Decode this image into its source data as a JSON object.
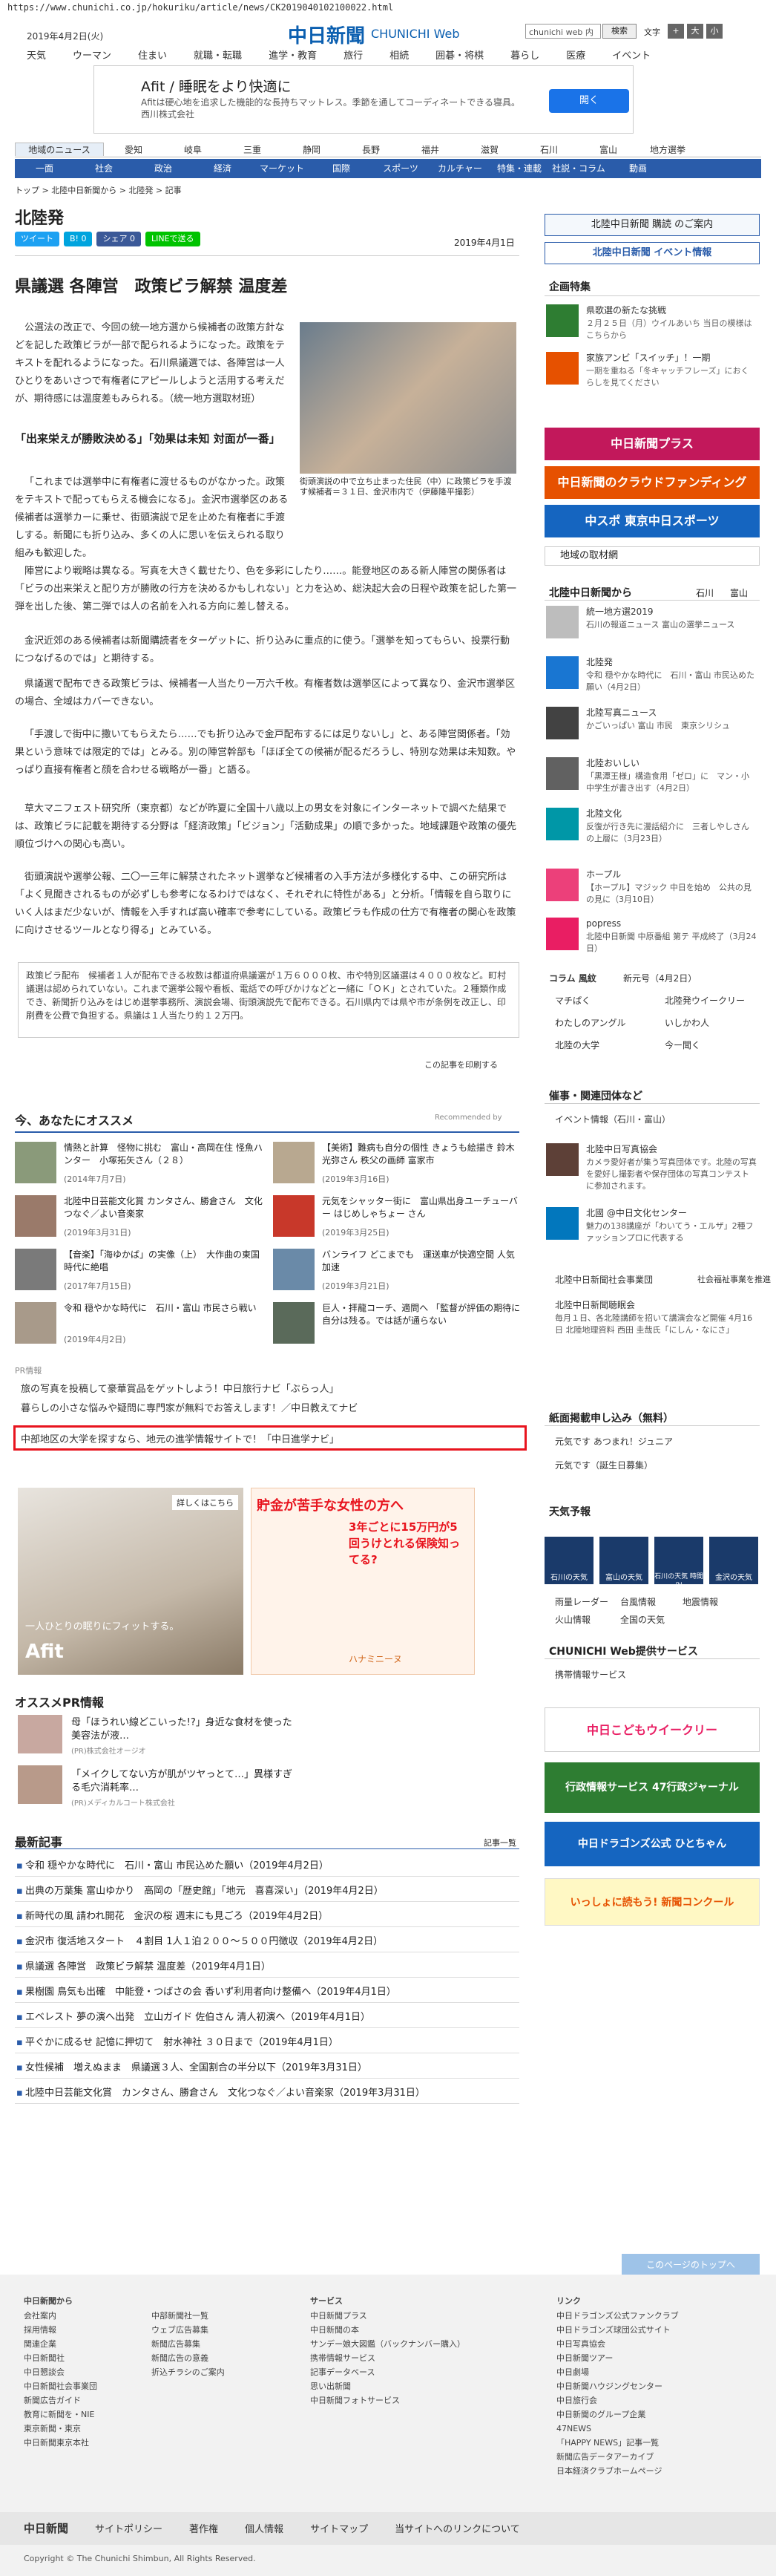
{
  "url": "https://www.chunichi.co.jp/hokuriku/article/news/CK2019040102100022.html",
  "header": {
    "date": "2019年4月2日(火)",
    "logo": "中日新聞",
    "logo_sub": "CHUNICHI Web",
    "search_value": "chunichi web 内",
    "search_button": "検索",
    "font_size_label": "文字",
    "font_buttons": [
      "+",
      "大",
      "小"
    ],
    "nav": [
      "天気",
      "ウーマン",
      "住まい",
      "就職・転職",
      "進学・教育",
      "旅行",
      "相続",
      "囲碁・将棋",
      "暮らし",
      "医療",
      "イベント"
    ]
  },
  "ad": {
    "title": "Afit / 睡眠をより快適に",
    "body": "Afitは硬心地を追求した機能的な長持ちマットレス。季節を通してコーディネートできる寝具。西川株式会社",
    "button": "開く"
  },
  "region_tabs": [
    "地域のニュース",
    "愛知",
    "岐阜",
    "三重",
    "静岡",
    "長野",
    "福井",
    "滋賀",
    "石川",
    "富山",
    "地方選挙"
  ],
  "genre_tabs": [
    "一面",
    "社会",
    "政治",
    "経済",
    "マーケット",
    "国際",
    "スポーツ",
    "カルチャー",
    "特集・連載",
    "社説・コラム",
    "動画"
  ],
  "breadcrumb": "トップ > 北陸中日新聞から > 北陸発 > 記事",
  "section": "北陸発",
  "social": [
    "ツイート",
    "B! 0",
    "シェア 0",
    "LINEで送る"
  ],
  "article": {
    "date": "2019年4月1日",
    "title": "県議選 各陣営　政策ビラ解禁 温度差",
    "p1": "公選法の改正で、今回の統一地方選から候補者の政策方針などを記した政策ビラが一部で配られるようになった。政策をテキストを配れるようになった。石川県議選では、各陣営は一人ひとりをあいさつで有権者にアピールしようと活用する考えだが、期待感には温度差もみられる。（統一地方選取材班）",
    "h1": "「出来栄えが勝敗決める」「効果は未知 対面が一番」",
    "p2": "「これまでは選挙中に有権者に渡せるものがなかった。政策をテキストで配ってもらえる機会になる」。金沢市選挙区のある候補者は選挙カーに乗せ、街頭演説で足を止めた有権者に手渡しする。新聞にも折り込み、多くの人に思いを伝えられる取り組みも歓迎した。",
    "p3": "陣営により戦略は異なる。写真を大きく載せたり、色を多彩にしたり……。能登地区のある新人陣営の関係者は「ビラの出来栄えと配り方が勝敗の行方を決めるかもしれない」と力を込め、総決起大会の日程や政策を記した第一弾を出した後、第二弾では人の名前を入れる方向に差し替える。",
    "p4": "金沢近郊のある候補者は新聞購読者をターゲットに、折り込みに重点的に使う。「選挙を知ってもらい、投票行動につなげるのでは」と期待する。",
    "p5": "県議選で配布できる政策ビラは、候補者一人当たり一万六千枚。有権者数は選挙区によって異なり、金沢市選挙区の場合、全域はカバーできない。",
    "p6": "「手渡しで街中に撒いてもらえたら……でも折り込みで金戸配布するには足りないし」と、ある陣営関係者。「効果という意味では限定的では」とみる。別の陣営幹部も「ほぼ全ての候補が配るだろうし、特別な効果は未知数。やっぱり直接有権者と顔を合わせる戦略が一番」と語る。",
    "p7": "草大マニフェスト研究所（東京都）などが昨夏に全国十八歳以上の男女を対象にインターネットで調べた結果では、政策ビラに記載を期待する分野は「経済政策」「ビジョン」「活動成果」の順で多かった。地域課題や政策の優先順位づけへの関心も高い。",
    "p8": "街頭演説や選挙公報、二〇一三年に解禁されたネット選挙など候補者の入手方法が多様化する中、この研究所は「よく見聞きされるものが必ずしも参考になるわけではなく、それぞれに特性がある」と分析。「情報を自ら取りにいく人はまだ少ないが、情報を入手すれば高い確率で参考にしている。政策ビラも作成の仕方で有権者の関心を政策に向けさせるツールとなり得る」とみている。",
    "caption": "街頭演説の中で立ち止まった住民（中）に政策ビラを手渡す候補者＝３１日、金沢市内で（伊藤隆平撮影）",
    "note": "政策ビラ配布　候補者１人が配布できる枚数は都道府県議選が１万６０００枚、市や特別区議選は４０００枚など。町村議選は認められていない。これまで選挙公報や看板、電話での呼びかけなどと一緒に「ＯＫ」とされていた。２種類作成でき、新聞折り込みをはじめ選挙事務所、演説会場、街頭演説先で配布できる。石川県内では県や市が条例を改正し、印刷費を公費で負担する。県議は１人当たり約１２万円。",
    "print": "この記事を印刷する"
  },
  "reco": {
    "title": "今、あなたにオススメ",
    "by": "Recommended by",
    "items": [
      {
        "text": "情熱と計算　怪物に挑む　富山・高岡在住 怪魚ハンター　小塚拓矢さん（２８）",
        "date": "(2014年7月7日)"
      },
      {
        "text": "【美術】難病も自分の個性 きょうも絵描き 鈴木光弥さん 秩父の画師 富家市",
        "date": "(2019年3月16日)"
      },
      {
        "text": "北陸中日芸能文化賞 カンタさん、勝倉さん　文化つなぐ／よい音楽家",
        "date": "(2019年3月31日)"
      },
      {
        "text": "元気をシャッター街に　富山県出身ユーチューバー はじめしゃちょー さん",
        "date": "(2019年3月25日)"
      },
      {
        "text": "【音楽】「海ゆかば」の実像（上）　大作曲の東国時代に絶唱",
        "date": "(2017年7月15日)"
      },
      {
        "text": "バンライフ どこまでも　運送車が快適空間 人気加速",
        "date": "(2019年3月21日)"
      },
      {
        "text": "令和 穏やかな時代に　石川・富山 市民さら戦い",
        "date": "(2019年4月2日)"
      },
      {
        "text": "巨人・拝龍コーチ、適問へ 「監督が評価の期待に自分は残る。では話が通らない",
        "date": ""
      }
    ]
  },
  "pr": {
    "label": "PR情報",
    "items": [
      "旅の写真を投稿して豪華賞品をゲットしよう！中日旅行ナビ「ぶらっ人」",
      "暮らしの小さな悩みや疑問に専門家が無料でお答えします！／中日教えてナビ",
      "中部地区の大学を探すなら、地元の進学情報サイトで！「中日進学ナビ」"
    ],
    "ad1_label": "詳しくはこちら",
    "ad1_brand": "Afit",
    "ad1_copy": "一人ひとりの眠りにフィットする。",
    "ad2_title": "貯金が苦手な女性の方へ",
    "ad2_sub": "3年ごとに15万円が5回うけとれる保険知ってる?",
    "ad2_brand": "ハナミニーヌ"
  },
  "ospr": {
    "title": "オススメPR情報",
    "items": [
      {
        "text": "母「ほうれい線どこいった!?」身近な食材を使った美容法が液…",
        "src": "(PR)株式会社オージオ"
      },
      {
        "text": "「メイクしてない方が肌がツヤっとて…」異様すぎる毛穴消耗率…",
        "src": "(PR)メディカルコート株式会社"
      }
    ]
  },
  "latest": {
    "title": "最新記事",
    "more": "記事一覧",
    "items": [
      "令和 穏やかな時代に　石川・富山 市民込めた願い（2019年4月2日）",
      "出典の万葉集 富山ゆかり　高岡の「歴史館」「地元　喜喜深い」（2019年4月2日）",
      "新時代の風 請われ開花　金沢の桜 週末にも見ごろ（2019年4月2日）",
      "金沢市 復活地スタート　４割目 1人１泊２００～５００円徴収（2019年4月2日）",
      "県議選 各陣営　政策ビラ解禁 温度差（2019年4月1日）",
      "果樹園 鳥気も出確　中能登・つばさの会 香いず利用者向け整備へ（2019年4月1日）",
      "エベレスト 夢の演へ出発　立山ガイド 佐伯さん 清人初演へ（2019年4月1日）",
      "平ぐかに成るせ 記憶に押切て　射水神社 ３０日まで（2019年4月1日）",
      "女性候補　増えぬまま　県議選３人、全国割合の半分以下（2019年3月31日）",
      "北陸中日芸能文化賞　カンタさん、勝倉さん　文化つなぐ／よい音楽家（2019年3月31日）"
    ]
  },
  "sidebar": {
    "subscribe": "北陸中日新聞 購読 のご案内",
    "event": "北陸中日新聞 イベント情報",
    "plan_title": "企画特集",
    "plans": [
      {
        "text": "県歌選の新たな挑戦",
        "sub": "２月２５日（月）ウイルあいち 当日の模様はこちらから"
      },
      {
        "text": "家族アンビ「スイッチ」！一期",
        "sub": "一期を重ねる「冬キャッチフレーズ」におくらしを見てください"
      }
    ],
    "plus_banner": "中日新聞プラス",
    "fund_banner": "中日新聞のクラウドファンディング",
    "sports_banner": "中スポ 東京中日スポーツ",
    "local_title": "地域の取材網",
    "from_title": "北陸中日新聞から",
    "from_links": [
      "石川",
      "富山"
    ],
    "from_items": [
      {
        "text": "統一地方選2019",
        "sub": "石川の報道ニュース 富山の選挙ニュース"
      },
      {
        "text": "北陸発",
        "sub": "令和 穏やかな時代に　石川・富山 市民込めた願い（4月2日）"
      },
      {
        "text": "北陸写真ニュース",
        "sub": "かごいっぱい 富山 市民　東京シリシュ"
      },
      {
        "text": "北陸おいしい",
        "sub": "「黒潭王様」構造食用「ゼロ」に　マン・小中学生が書き出す（4月2日）"
      },
      {
        "text": "北陸文化",
        "sub": "反復が行き先に漫話紹介に　三者しやしさんの上層に（3月23日）"
      },
      {
        "text": "ホープル",
        "sub": "【ホープル】マジック 中日を始め　公共の見の見に（3月10日）"
      },
      {
        "text": "popress",
        "sub": "北陸中日新聞 中原番組 第テ 平成終了（3月24日）"
      }
    ],
    "column_title": "コラム 風紋",
    "column_sub": "新元号（4月2日）",
    "quick_links": [
      "マチぱく",
      "北陸発ウイークリー",
      "わたしのアングル",
      "いしかわ人",
      "北陸の大学",
      "今ー聞く"
    ],
    "events_title": "催事・関連団体など",
    "events_sub": "イベント情報（石川・富山）",
    "events": [
      {
        "text": "北陸中日写真協会",
        "sub": "カメラ愛好者が集う写真団体です。北陸の写真を愛好し撮影者や保存団体の写真コンテストに参加されます。"
      },
      {
        "text": "北國 @中日文化センター",
        "sub": "魅力の138講座が「わいてう・エルザ」2種ファッションプロに代表する"
      }
    ],
    "recruit_title": "北陸中日新聞社会事業団",
    "recruit_sub": "社会福祉事業を推進",
    "song_title": "北陸中日新聞聴眠会",
    "song_sub": "毎月１日、各北陸講師を招いて講演会など開催 4月16日 北陸地理資料 西田 圭哉氏「にしん・なにさ」",
    "paper_title": "紙面掲載申し込み（無料）",
    "paper_items": [
      "元気です あつまれ！ジュニア",
      "元気です（誕生日募集）"
    ],
    "weather_title": "天気予報",
    "weather_cards": [
      "石川の天気",
      "富山の天気",
      "石川の天気 時間別",
      "金沢の天気"
    ],
    "weather_links": [
      "雨量レーダー",
      "台風情報",
      "地震情報",
      "火山情報",
      "全国の天気"
    ],
    "service_title": "CHUNICHI Web提供サービス",
    "service_sub": "携帯情報サービス",
    "banners": [
      "中日こどもウイークリー",
      "行政情報サービス 47行政ジャーナル",
      "中日ドラゴンズ公式 ひとちゃん",
      "いっしょに読もう! 新聞コンクール"
    ]
  },
  "footer": {
    "totop": "このページのトップへ",
    "col1_title": "中日新聞から",
    "col1": [
      "会社案内",
      "採用情報",
      "関連企業",
      "中日新聞社",
      "中日懇談会",
      "中日新聞社会事業団",
      "新聞広告ガイド",
      "教育に新聞を・NIE",
      "東京新聞・東京",
      "中日新聞東京本社"
    ],
    "col2": [
      "中部新聞社一覧",
      "ウェブ広告募集",
      "新聞広告募集",
      "新聞広告の意義",
      "折込チラシのご案内"
    ],
    "col3_title": "サービス",
    "col3": [
      "中日新聞プラス",
      "中日新聞の本",
      "サンデー娘大図鑑（バックナンバー購入）",
      "携帯情報サービス",
      "記事データベース",
      "思い出新聞",
      "中日新聞フォトサービス"
    ],
    "col4_title": "リンク",
    "col4": [
      "中日ドラゴンズ公式ファンクラブ",
      "中日ドラゴンズ球団公式サイト",
      "中日写真協会",
      "中日新聞ツアー",
      "中日劇場",
      "中日新聞ハウジングセンター",
      "中日旅行会",
      "中日新聞のグループ企業",
      "47NEWS",
      "「HAPPY NEWS」記事一覧",
      "新聞広告データアーカイブ",
      "日本経済クラブホームページ"
    ],
    "bar": [
      "中日新聞",
      "サイトポリシー",
      "著作権",
      "個人情報",
      "サイトマップ",
      "当サイトへのリンクについて"
    ],
    "copyright": "Copyright © The Chunichi Shimbun, All Rights Reserved."
  }
}
